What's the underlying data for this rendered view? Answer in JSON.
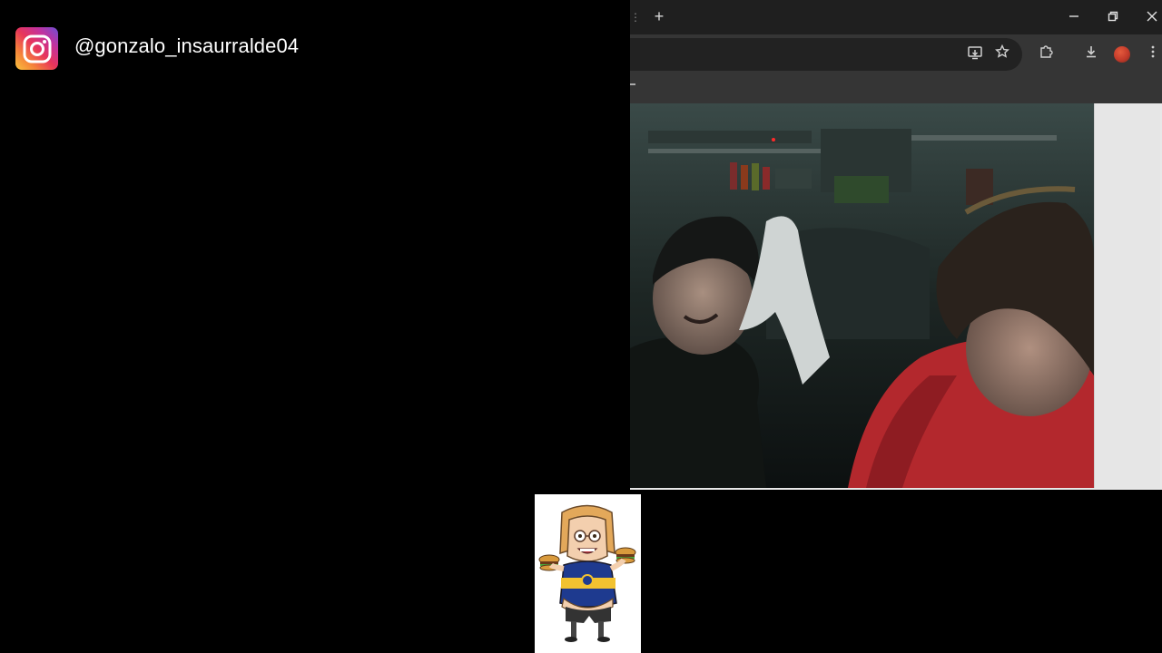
{
  "overlay": {
    "instagram": {
      "icon": "instagram-icon",
      "handle": "@gonzalo_insaurralde04"
    }
  },
  "browser": {
    "titlebar": {
      "new_tab_icon": "plus-icon",
      "controls": [
        "minimize-icon",
        "restore-icon",
        "close-icon"
      ]
    },
    "toolbar": {
      "icons": [
        "install-app-icon",
        "bookmark-star-icon",
        "extensions-icon",
        "downloads-icon",
        "profile-avatar",
        "kebab-menu-icon"
      ]
    },
    "content": {
      "video_description_icon": "webcam-video",
      "side_panel": ""
    }
  },
  "sticker": {
    "icon": "cartoon-character-sticker"
  }
}
